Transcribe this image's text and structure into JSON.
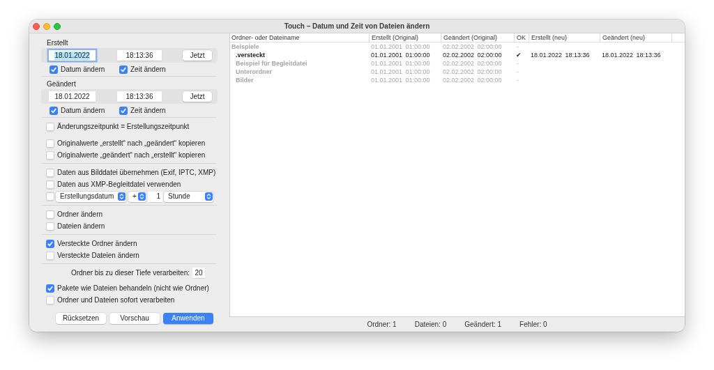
{
  "window": {
    "title": "Touch – Datum und Zeit von Dateien ändern"
  },
  "created": {
    "label": "Erstellt",
    "date": {
      "value": "18.01.2022",
      "focused": true
    },
    "time": {
      "value": "18:13:36",
      "focused": false
    },
    "now_button": "Jetzt",
    "checkboxes": [
      {
        "label": "Datum ändern",
        "checked": true
      },
      {
        "label": "Zeit ändern",
        "checked": true
      }
    ]
  },
  "modified": {
    "label": "Geändert",
    "date": {
      "value": "18.01.2022",
      "focused": false
    },
    "time": {
      "value": "18:13:36",
      "focused": false
    },
    "now_button": "Jetzt",
    "checkboxes": [
      {
        "label": "Datum ändern",
        "checked": true
      },
      {
        "label": "Zeit ändern",
        "checked": true
      }
    ]
  },
  "sections": [
    {
      "groups": [
        {
          "items": [
            {
              "kind": "checkbox",
              "label": "Änderungszeitpunkt = Erstellungszeitpunkt",
              "checked": false
            }
          ]
        },
        {
          "items": [
            {
              "kind": "checkbox",
              "label": "Originalwerte „erstellt“ nach „geändert“ kopieren",
              "checked": false
            },
            {
              "kind": "checkbox",
              "label": "Originalwerte „geändert“ nach „erstellt“ kopieren",
              "checked": false
            }
          ]
        }
      ]
    },
    {
      "groups": [
        {
          "items": [
            {
              "kind": "checkbox",
              "label": "Daten aus Bilddatei übernehmen (Exif, IPTC, XMP)",
              "checked": false
            },
            {
              "kind": "checkbox",
              "label": "Daten aus XMP-Begleitdatei verwenden",
              "checked": false
            },
            {
              "kind": "offset",
              "checked": false,
              "field": "Erstellungsdatum",
              "sign": "+",
              "amount": "1",
              "unit": "Stunde"
            }
          ]
        }
      ]
    },
    {
      "groups": [
        {
          "items": [
            {
              "kind": "checkbox",
              "label": "Ordner ändern",
              "checked": false
            },
            {
              "kind": "checkbox",
              "label": "Dateien ändern",
              "checked": false
            }
          ]
        }
      ]
    },
    {
      "groups": [
        {
          "items": [
            {
              "kind": "checkbox",
              "label": "Versteckte Ordner ändern",
              "checked": true
            },
            {
              "kind": "checkbox",
              "label": "Versteckte Dateien ändern",
              "checked": false
            }
          ]
        }
      ]
    },
    {
      "groups": [
        {
          "items": [
            {
              "kind": "depth",
              "label": "Ordner bis zu dieser Tiefe verarbeiten:",
              "value": "20"
            }
          ]
        },
        {
          "items": [
            {
              "kind": "checkbox",
              "label": "Pakete wie Dateien behandeln (nicht wie Ordner)",
              "checked": true
            },
            {
              "kind": "checkbox",
              "label": "Ordner und Dateien sofort verarbeiten",
              "checked": false
            }
          ]
        }
      ]
    }
  ],
  "buttons": [
    {
      "label": "Rücksetzen",
      "default": false
    },
    {
      "label": "Vorschau",
      "default": false
    },
    {
      "label": "Anwenden",
      "default": true
    }
  ],
  "table": {
    "columns": [
      "Ordner- oder Dateiname",
      "Erstellt (Original)",
      "Geändert (Original)",
      "OK",
      "Erstellt (neu)",
      "Geändert (neu)"
    ],
    "rows": [
      {
        "name": "Beispiele",
        "changed": false,
        "created_original": "01.01.2001 01:00:00",
        "modified_original": "02.02.2002 02:00:00",
        "ok": "–",
        "children": [
          {
            "name": ".versteckt",
            "changed": true,
            "created_original": "01.01.2001 01:00:00",
            "modified_original": "02.02.2002 02:00:00",
            "ok": "✔",
            "created_new": "18.01.2022 18:13:36",
            "modified_new": "18.01.2022 18:13:36"
          },
          {
            "name": "Beispiel für Begleitdatei",
            "changed": false,
            "created_original": "01.01.2001 01:00:00",
            "modified_original": "02.02.2002 02:00:00",
            "ok": "–"
          },
          {
            "name": "Unterordner",
            "changed": false,
            "created_original": "01.01.2001 01:00:00",
            "modified_original": "02.02.2002 02:00:00",
            "ok": "–"
          },
          {
            "name": "Bilder",
            "changed": false,
            "created_original": "01.01.2001 01:00:00",
            "modified_original": "02.02.2002 02:00:00",
            "ok": "–"
          }
        ]
      }
    ]
  },
  "status_bar": [
    "Ordner: 1",
    "Dateien: 0",
    "Geändert: 1",
    "Fehler: 0"
  ]
}
